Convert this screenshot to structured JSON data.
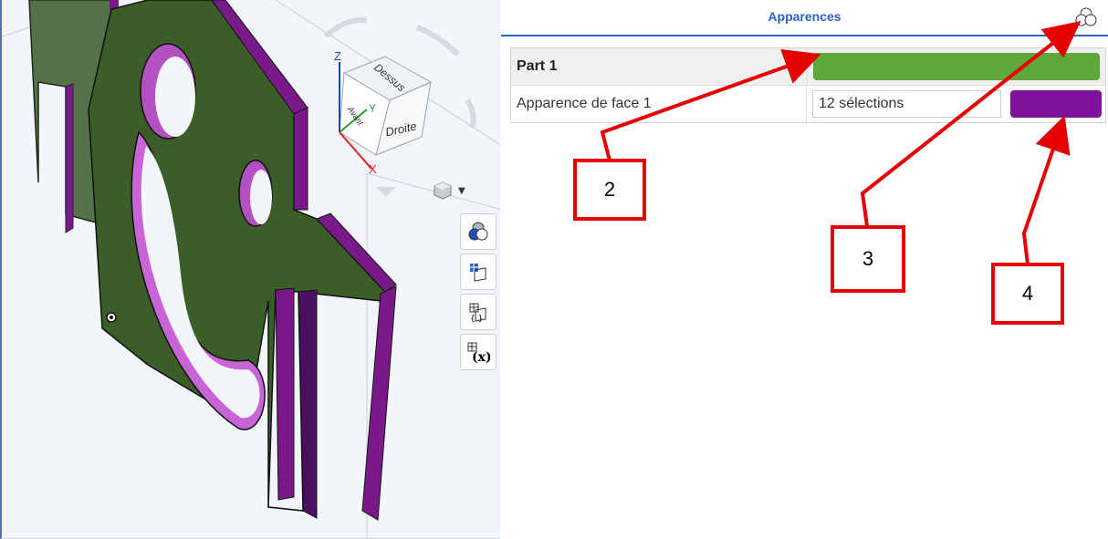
{
  "viewport": {
    "view_cube": {
      "top": "Dessus",
      "front": "Avant",
      "right": "Droite"
    },
    "axes": {
      "x": "X",
      "y": "Y",
      "z": "Z"
    },
    "colors": {
      "part_face": "#3b5d27",
      "part_edge": "#7a1a8a",
      "hole_inner": "#b44fc4"
    },
    "toolbar_icons": [
      "appearance-icon",
      "section-view-icon",
      "named-views-icon",
      "variables-icon"
    ],
    "view_dropdown_icon": "view-cube-icon"
  },
  "panel": {
    "title": "Apparences",
    "add_button_icon": "add-appearance-icon",
    "rows": [
      {
        "name": "Part 1",
        "color": "#5ea83a"
      },
      {
        "name": "Apparence de face 1",
        "selection": "12 sélections",
        "color": "#7e129a"
      }
    ]
  },
  "annotations": {
    "callout_2": "2",
    "callout_3": "3",
    "callout_4": "4",
    "color": "#e60000"
  }
}
